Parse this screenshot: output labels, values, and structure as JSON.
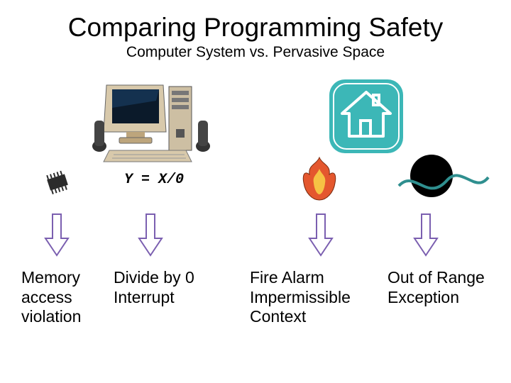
{
  "title": "Comparing Programming Safety",
  "subtitle": "Computer System vs. Pervasive Space",
  "code_expr": "Y = X/0",
  "labels": {
    "memory": "Memory access violation",
    "divide": "Divide by 0 Interrupt",
    "fire": "Fire Alarm Impermissible Context",
    "range": "Out of Range Exception"
  },
  "colors": {
    "house_badge": "#3CB7B7",
    "arrow_fill": "#ffffff",
    "arrow_stroke": "#7b5fb0"
  }
}
